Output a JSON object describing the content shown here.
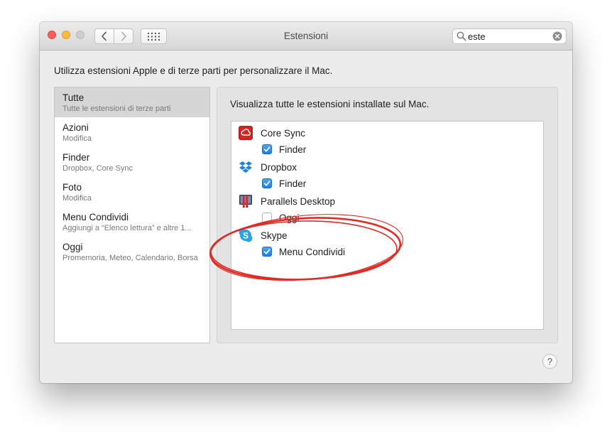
{
  "window": {
    "title": "Estensioni"
  },
  "toolbar": {
    "back_icon": "chevron-left-icon",
    "forward_icon": "chevron-right-icon",
    "show_all_icon": "grid-icon"
  },
  "search": {
    "value": "este"
  },
  "description": "Utilizza estensioni Apple e di terze parti per personalizzare il Mac.",
  "sidebar": {
    "items": [
      {
        "title": "Tutte",
        "subtitle": "Tutte le estensioni di terze parti",
        "selected": true
      },
      {
        "title": "Azioni",
        "subtitle": "Modifica"
      },
      {
        "title": "Finder",
        "subtitle": "Dropbox, Core Sync"
      },
      {
        "title": "Foto",
        "subtitle": "Modifica"
      },
      {
        "title": "Menu Condividi",
        "subtitle": "Aggiungi a “Elenco lettura” e altre 1..."
      },
      {
        "title": "Oggi",
        "subtitle": "Promemoria, Meteo, Calendario, Borsa"
      }
    ]
  },
  "panel": {
    "heading": "Visualizza tutte le estensioni installate sul Mac.",
    "extensions": [
      {
        "app": "Core Sync",
        "icon": "creative-cloud-icon",
        "option": "Finder",
        "checked": true
      },
      {
        "app": "Dropbox",
        "icon": "dropbox-icon",
        "option": "Finder",
        "checked": true
      },
      {
        "app": "Parallels Desktop",
        "icon": "parallels-icon",
        "option": "Oggi",
        "checked": false
      },
      {
        "app": "Skype",
        "icon": "skype-icon",
        "option": "Menu Condividi",
        "checked": true
      }
    ]
  },
  "help": {
    "label": "?"
  },
  "colors": {
    "accent": "#1a7ef0",
    "annotation": "#e02a24",
    "selection": "#d6d6d6"
  }
}
